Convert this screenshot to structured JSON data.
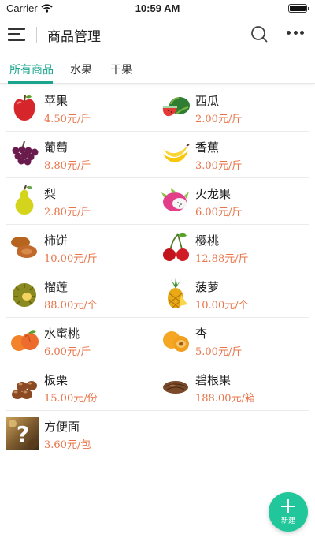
{
  "status": {
    "carrier": "Carrier",
    "time": "10:59 AM"
  },
  "nav": {
    "title": "商品管理",
    "menu_icon": "hamburger-menu-icon",
    "search_icon": "search-icon",
    "more_icon": "more-icon"
  },
  "tabs": [
    {
      "label": "所有商品",
      "active": true
    },
    {
      "label": "水果",
      "active": false
    },
    {
      "label": "干果",
      "active": false
    }
  ],
  "colors": {
    "accent": "#1aa58c",
    "price": "#e8744a",
    "fab": "#21c79a"
  },
  "products": [
    {
      "name": "苹果",
      "price": "4.50元/斤",
      "icon": "apple-icon"
    },
    {
      "name": "西瓜",
      "price": "2.00元/斤",
      "icon": "watermelon-icon"
    },
    {
      "name": "葡萄",
      "price": "8.80元/斤",
      "icon": "grapes-icon"
    },
    {
      "name": "香蕉",
      "price": "3.00元/斤",
      "icon": "banana-icon"
    },
    {
      "name": "梨",
      "price": "2.80元/斤",
      "icon": "pear-icon"
    },
    {
      "name": "火龙果",
      "price": "6.00元/斤",
      "icon": "dragon-fruit-icon"
    },
    {
      "name": "柿饼",
      "price": "10.00元/斤",
      "icon": "dried-persimmon-icon"
    },
    {
      "name": "樱桃",
      "price": "12.88元/斤",
      "icon": "cherry-icon"
    },
    {
      "name": "榴莲",
      "price": "88.00元/个",
      "icon": "durian-icon"
    },
    {
      "name": "菠萝",
      "price": "10.00元/个",
      "icon": "pineapple-icon"
    },
    {
      "name": "水蜜桃",
      "price": "6.00元/斤",
      "icon": "peach-icon"
    },
    {
      "name": "杏",
      "price": "5.00元/斤",
      "icon": "apricot-icon"
    },
    {
      "name": "板栗",
      "price": "15.00元/份",
      "icon": "chestnut-icon"
    },
    {
      "name": "碧根果",
      "price": "188.00元/箱",
      "icon": "pecan-icon"
    },
    {
      "name": "方便面",
      "price": "3.60元/包",
      "icon": "unknown-product-icon"
    }
  ],
  "fab": {
    "label": "新建",
    "icon": "plus-icon"
  }
}
